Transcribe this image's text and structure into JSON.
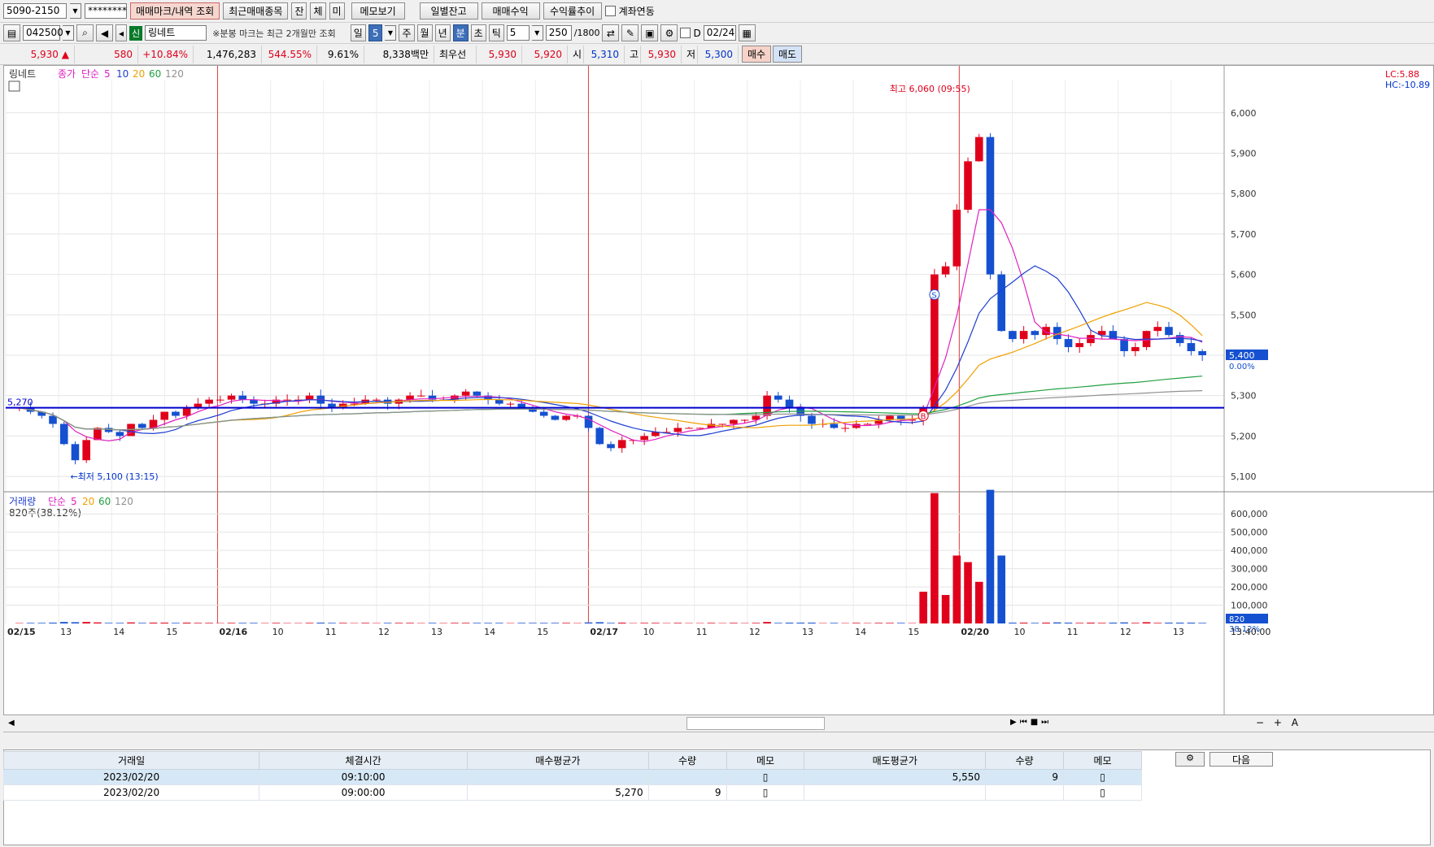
{
  "account": {
    "number": "5090-2150",
    "password": "********"
  },
  "toolbar": {
    "buttons": [
      "매매마크/내역 조회",
      "최근매매종목",
      "잔",
      "체",
      "미",
      "메모보기",
      "일별잔고",
      "매매수익",
      "수익률추이"
    ],
    "account_link_label": "계좌연동"
  },
  "chart_toolbar": {
    "code": "042500",
    "market_badge": "신",
    "stock_name": "링네트",
    "notice": "※분봉 마크는 최근 2개월만 조회",
    "periods": [
      "일",
      "주",
      "월",
      "년",
      "분",
      "초",
      "틱"
    ],
    "active_period": "분",
    "period_dropdown_value": "5",
    "interval_value": "5",
    "count_label": "250",
    "count_max": "/1800",
    "d_label": "D",
    "date_value": "02/24"
  },
  "quote": {
    "price": "5,930",
    "arrow": "▲",
    "change": "580",
    "change_pct": "+10.84%",
    "volume": "1,476,283",
    "vol_ratio": "544.55%",
    "turnover": "9.61%",
    "amount": "8,338백만",
    "best_ask_label": "최우선",
    "best_ask": "5,930",
    "best_bid": "5,920",
    "open_label": "시",
    "open": "5,310",
    "high_label": "고",
    "high": "5,930",
    "low_label": "저",
    "low": "5,300",
    "buy_button": "매수",
    "sell_button": "매도"
  },
  "chart_data": {
    "type": "candlestick",
    "panels": [
      {
        "name": "price",
        "title": "링네트",
        "legend": {
          "label": "종가",
          "method": "단순",
          "periods": [
            "5",
            "10",
            "20",
            "60",
            "120"
          ],
          "colors": [
            "#e020c0",
            "#1f3fd0",
            "#f0a000",
            "#20a040",
            "#909090"
          ]
        },
        "y_ticks": [
          "6,000",
          "5,900",
          "5,800",
          "5,700",
          "5,600",
          "5,500",
          "5,400",
          "5,300",
          "5,200",
          "5,100"
        ],
        "ylim": [
          5070,
          6080
        ],
        "annotations": {
          "high": "최고 6,060 (09:55)",
          "low": "←최저 5,100 (13:15)",
          "ref_line_value": "5,270",
          "current_badge": "5,400",
          "current_pct": "0.00%",
          "lc": "LC:5.88",
          "hc": "HC:-10.89"
        },
        "series_close_segments": [
          {
            "label": "02/15",
            "values": [
              5270,
              5260,
              5250,
              5230,
              5180,
              5140,
              5190,
              5220,
              5210,
              5200,
              5230,
              5220,
              5240,
              5260,
              5250,
              5270,
              5280,
              5290,
              5290,
              5300,
              5290,
              5280,
              5280,
              5290,
              5290
            ]
          },
          {
            "label": "02/16",
            "values": [
              5290,
              5300,
              5280,
              5270,
              5280,
              5280,
              5290,
              5290,
              5280,
              5290,
              5300,
              5300,
              5290,
              5290,
              5300,
              5310,
              5300,
              5290,
              5280,
              5280,
              5270,
              5260,
              5250,
              5240,
              5250,
              5250
            ]
          },
          {
            "label": "02/17",
            "values": [
              5220,
              5180,
              5170,
              5190,
              5190,
              5200,
              5210,
              5210,
              5220,
              5220,
              5220,
              5230,
              5230,
              5240,
              5240,
              5250,
              5300,
              5290,
              5270,
              5250,
              5230,
              5230,
              5220,
              5220,
              5230,
              5230,
              5240,
              5250,
              5240,
              5240
            ]
          },
          {
            "label": "02/20",
            "values": [
              5270,
              5600,
              5620,
              5760,
              5880,
              5940,
              5600,
              5460,
              5440,
              5460,
              5450,
              5470,
              5440,
              5420,
              5430,
              5450,
              5460,
              5440,
              5410,
              5420,
              5460,
              5470,
              5450,
              5430,
              5410,
              5400
            ]
          }
        ],
        "markers": [
          "S",
          "B"
        ]
      },
      {
        "name": "volume",
        "title": "거래량",
        "legend": {
          "method": "단순",
          "periods": [
            "5",
            "20",
            "60",
            "120"
          ]
        },
        "current": "820주(38.12%)",
        "y_ticks": [
          "600,000",
          "500,000",
          "400,000",
          "300,000",
          "200,000",
          "100,000"
        ],
        "ylim": [
          0,
          650000
        ],
        "current_badge": "820",
        "current_pct": "38.12%"
      }
    ],
    "x_labels": [
      "02/15",
      "13",
      "14",
      "15",
      "02/16",
      "10",
      "11",
      "12",
      "13",
      "14",
      "15",
      "02/17",
      "10",
      "11",
      "12",
      "13",
      "14",
      "15",
      "02/20",
      "10",
      "11",
      "12",
      "13"
    ],
    "x_time_label": "13:40:00"
  },
  "bottom_toolbar": {
    "next_button": "다음"
  },
  "trade_table": {
    "headers": [
      "거래일",
      "체결시간",
      "매수평균가",
      "수량",
      "메모",
      "매도평균가",
      "수량",
      "메모"
    ],
    "rows": [
      [
        "2023/02/20",
        "09:10:00",
        "",
        "",
        "",
        "5,550",
        "9",
        ""
      ],
      [
        "2023/02/20",
        "09:00:00",
        "5,270",
        "9",
        "",
        "",
        "",
        ""
      ]
    ]
  }
}
